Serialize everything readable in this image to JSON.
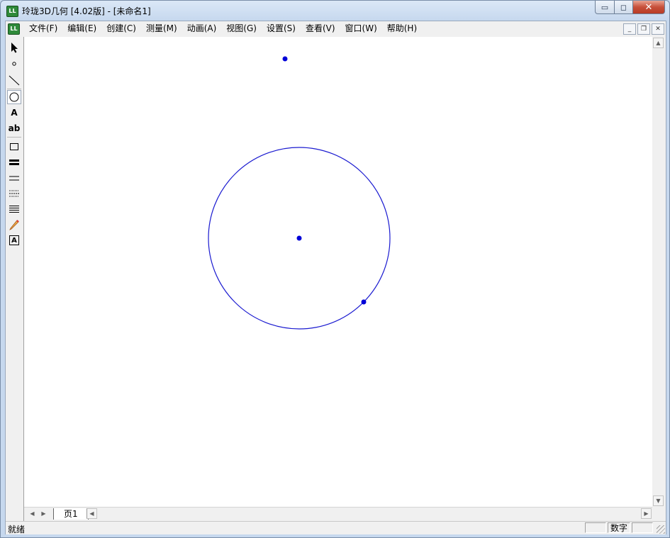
{
  "window": {
    "title": "玲珑3D几何 [4.02版] - [未命名1]",
    "icon_label": "LL",
    "controls": {
      "minimize": "▭",
      "maximize": "◻",
      "close": "✕"
    }
  },
  "menubar": {
    "items": [
      "文件(F)",
      "编辑(E)",
      "创建(C)",
      "测量(M)",
      "动画(A)",
      "视图(G)",
      "设置(S)",
      "查看(V)",
      "窗口(W)",
      "帮助(H)"
    ],
    "mdi_controls": {
      "minimize": "_",
      "restore": "❐",
      "close": "✕"
    }
  },
  "toolbox": {
    "tools": [
      {
        "name": "arrow-select-tool",
        "icon": "arrow-icon"
      },
      {
        "name": "point-tool",
        "icon": "point-icon"
      },
      {
        "name": "line-tool",
        "icon": "line-icon"
      },
      {
        "name": "circle-tool",
        "icon": "circle-icon",
        "active": true
      },
      {
        "name": "text-tool",
        "icon": "text-A-icon",
        "label": "A"
      },
      {
        "name": "label-tool",
        "icon": "text-ab-icon",
        "label": "ab"
      },
      {
        "name": "rectangle-tool",
        "icon": "rectangle-icon"
      },
      {
        "name": "thick-line-tool",
        "icon": "thick-line-icon"
      },
      {
        "name": "thin-line-tool",
        "icon": "thin-line-icon"
      },
      {
        "name": "dotted-line-tool",
        "icon": "dotted-line-icon"
      },
      {
        "name": "multi-line-tool",
        "icon": "multi-line-icon"
      },
      {
        "name": "pencil-tool",
        "icon": "pencil-icon"
      },
      {
        "name": "text-frame-tool",
        "icon": "text-frame-icon",
        "label": "A"
      }
    ]
  },
  "canvas": {
    "stroke_color": "#1a1ad0",
    "point_color": "#0000d8"
  },
  "pages": {
    "tab_label": "页1"
  },
  "statusbar": {
    "text": "就绪",
    "num_indicator": "数字"
  }
}
